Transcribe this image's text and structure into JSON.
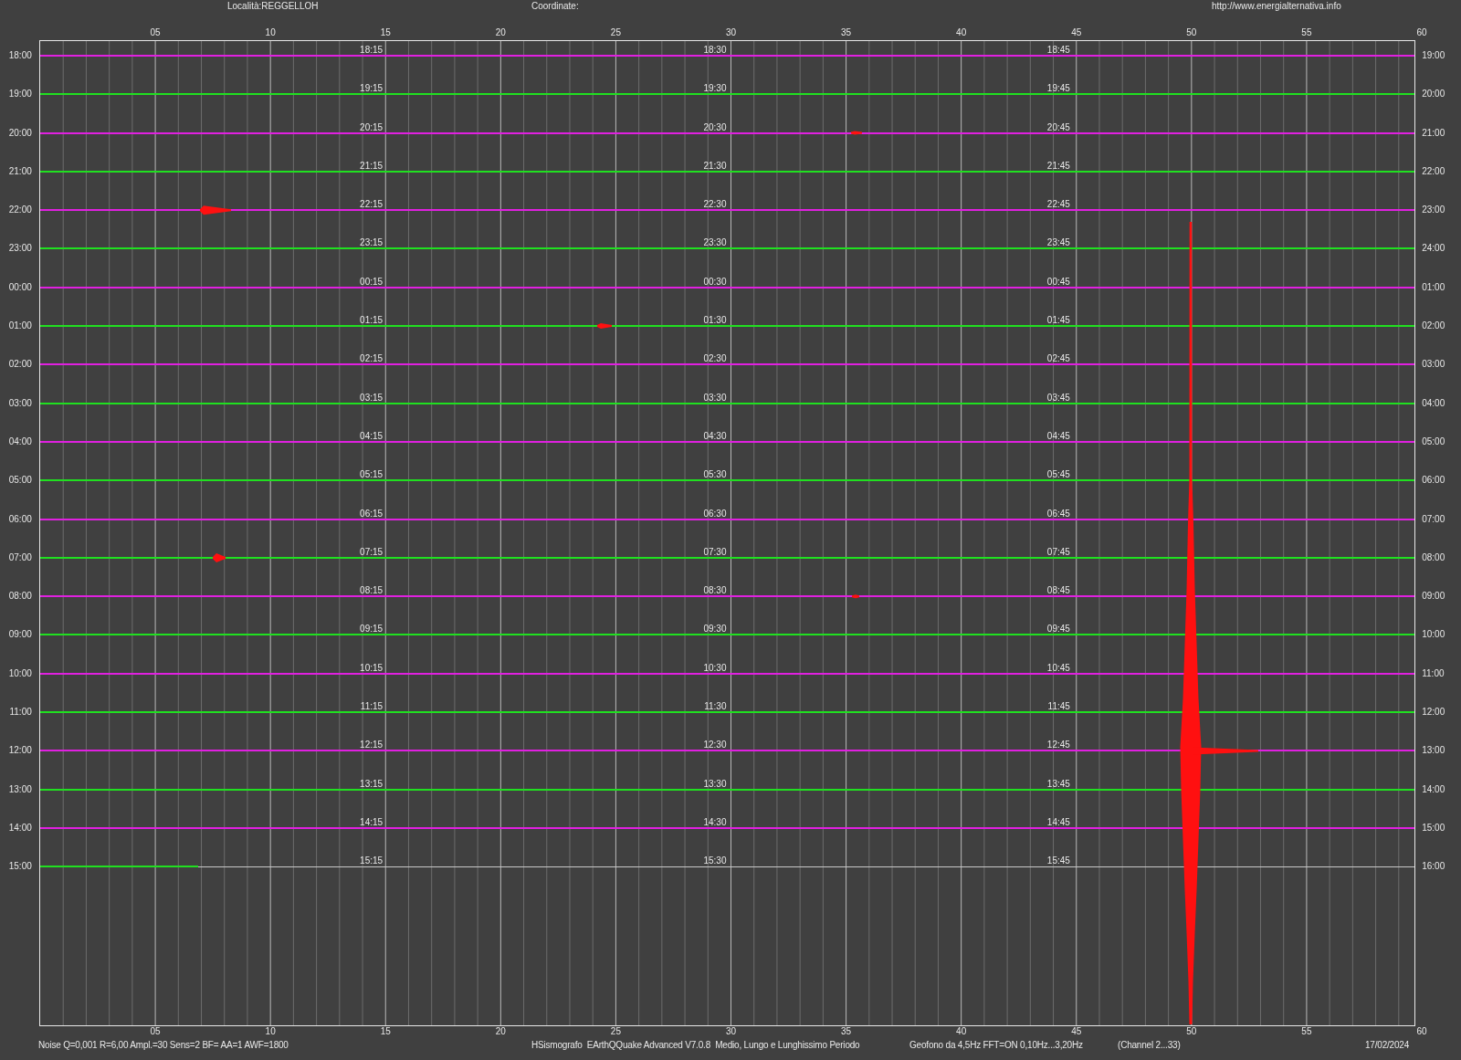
{
  "header": {
    "location": "Località:REGGELLOH",
    "coordinates": "Coordinate:",
    "website": "http://www.energialternativa.info"
  },
  "top_axis": [
    "05",
    "10",
    "15",
    "20",
    "25",
    "30",
    "35",
    "40",
    "45",
    "50",
    "55",
    "60"
  ],
  "rows": [
    {
      "left": "18:00",
      "quarters": [
        "18:15",
        "18:30",
        "18:45"
      ],
      "right": "19:00",
      "color": "#e020e0"
    },
    {
      "left": "19:00",
      "quarters": [
        "19:15",
        "19:30",
        "19:45"
      ],
      "right": "20:00",
      "color": "#20e020"
    },
    {
      "left": "20:00",
      "quarters": [
        "20:15",
        "20:30",
        "20:45"
      ],
      "right": "21:00",
      "color": "#e020e0"
    },
    {
      "left": "21:00",
      "quarters": [
        "21:15",
        "21:30",
        "21:45"
      ],
      "right": "22:00",
      "color": "#20e020"
    },
    {
      "left": "22:00",
      "quarters": [
        "22:15",
        "22:30",
        "22:45"
      ],
      "right": "23:00",
      "color": "#e020e0"
    },
    {
      "left": "23:00",
      "quarters": [
        "23:15",
        "23:30",
        "23:45"
      ],
      "right": "24:00",
      "color": "#20e020"
    },
    {
      "left": "00:00",
      "quarters": [
        "00:15",
        "00:30",
        "00:45"
      ],
      "right": "01:00",
      "color": "#e020e0"
    },
    {
      "left": "01:00",
      "quarters": [
        "01:15",
        "01:30",
        "01:45"
      ],
      "right": "02:00",
      "color": "#20e020"
    },
    {
      "left": "02:00",
      "quarters": [
        "02:15",
        "02:30",
        "02:45"
      ],
      "right": "03:00",
      "color": "#e020e0"
    },
    {
      "left": "03:00",
      "quarters": [
        "03:15",
        "03:30",
        "03:45"
      ],
      "right": "04:00",
      "color": "#20e020"
    },
    {
      "left": "04:00",
      "quarters": [
        "04:15",
        "04:30",
        "04:45"
      ],
      "right": "05:00",
      "color": "#e020e0"
    },
    {
      "left": "05:00",
      "quarters": [
        "05:15",
        "05:30",
        "05:45"
      ],
      "right": "06:00",
      "color": "#20e020"
    },
    {
      "left": "06:00",
      "quarters": [
        "06:15",
        "06:30",
        "06:45"
      ],
      "right": "07:00",
      "color": "#e020e0"
    },
    {
      "left": "07:00",
      "quarters": [
        "07:15",
        "07:30",
        "07:45"
      ],
      "right": "08:00",
      "color": "#20e020"
    },
    {
      "left": "08:00",
      "quarters": [
        "08:15",
        "08:30",
        "08:45"
      ],
      "right": "09:00",
      "color": "#e020e0"
    },
    {
      "left": "09:00",
      "quarters": [
        "09:15",
        "09:30",
        "09:45"
      ],
      "right": "10:00",
      "color": "#20e020"
    },
    {
      "left": "10:00",
      "quarters": [
        "10:15",
        "10:30",
        "10:45"
      ],
      "right": "11:00",
      "color": "#e020e0"
    },
    {
      "left": "11:00",
      "quarters": [
        "11:15",
        "11:30",
        "11:45"
      ],
      "right": "12:00",
      "color": "#20e020"
    },
    {
      "left": "12:00",
      "quarters": [
        "12:15",
        "12:30",
        "12:45"
      ],
      "right": "13:00",
      "color": "#e020e0"
    },
    {
      "left": "13:00",
      "quarters": [
        "13:15",
        "13:30",
        "13:45"
      ],
      "right": "14:00",
      "color": "#20e020"
    },
    {
      "left": "14:00",
      "quarters": [
        "14:15",
        "14:30",
        "14:45"
      ],
      "right": "15:00",
      "color": "#e020e0"
    },
    {
      "left": "15:00",
      "quarters": [
        "15:15",
        "15:30",
        "15:45"
      ],
      "right": "16:00",
      "color": "#20e020",
      "level": 0.115
    }
  ],
  "bottom_axis": [
    "05",
    "10",
    "15",
    "20",
    "25",
    "30",
    "35",
    "40",
    "45",
    "50",
    "55",
    "60"
  ],
  "footer": {
    "settings": "Noise Q=0,001 R=6,00 Ampl.=30 Sens=2 BF= AA=1 AWF=1800",
    "program": "HSismografo  EArthQQuake Advanced V7.0.8  Medio, Lungo e Lunghissimo Periodo",
    "sensor": "Geofono da 4,5Hz FFT=ON 0,10Hz...3,20Hz",
    "channel": "(Channel 2...33)",
    "date": "17/02/2024"
  }
}
